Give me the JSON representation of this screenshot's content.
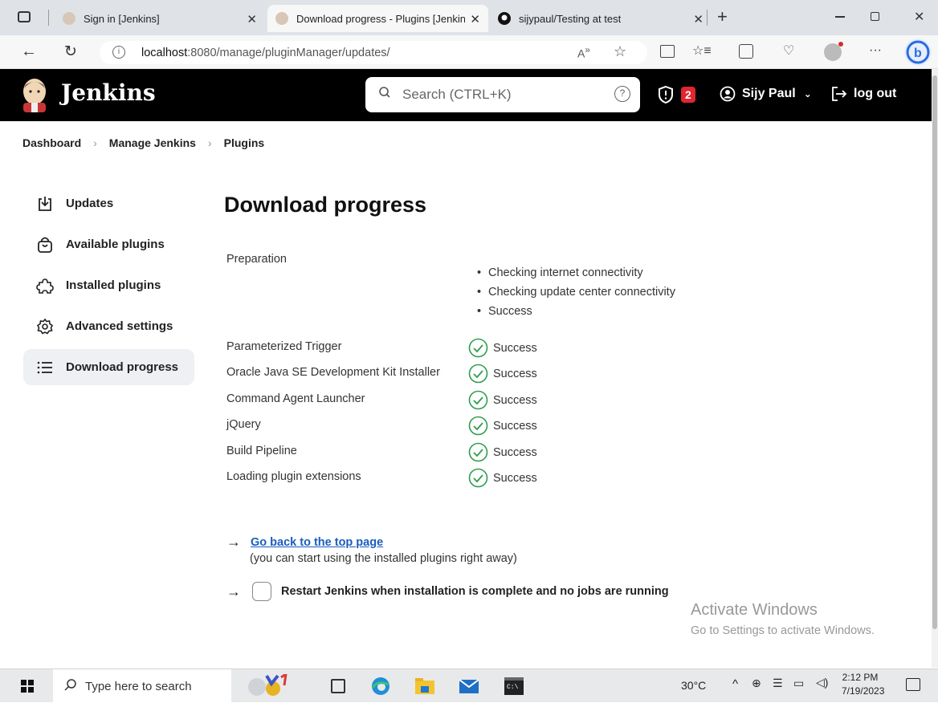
{
  "browser": {
    "tabs": [
      {
        "title": "Sign in [Jenkins]",
        "active": false
      },
      {
        "title": "Download progress - Plugins [Jenkins]",
        "active": true
      },
      {
        "title": "sijypaul/Testing at test",
        "active": false
      }
    ],
    "url_host": "localhost",
    "url_rest": ":8080/manage/pluginManager/updates/"
  },
  "header": {
    "brand": "Jenkins",
    "search_placeholder": "Search (CTRL+K)",
    "security_count": "2",
    "user": "Sijy Paul",
    "logout": "log out"
  },
  "breadcrumb": [
    "Dashboard",
    "Manage Jenkins",
    "Plugins"
  ],
  "sidebar": {
    "items": [
      {
        "label": "Updates",
        "icon": "download-icon"
      },
      {
        "label": "Available plugins",
        "icon": "shopping-bag-icon"
      },
      {
        "label": "Installed plugins",
        "icon": "puzzle-icon"
      },
      {
        "label": "Advanced settings",
        "icon": "gear-icon"
      },
      {
        "label": "Download progress",
        "icon": "list-icon"
      }
    ]
  },
  "main": {
    "title": "Download progress",
    "preparation_label": "Preparation",
    "preparation_steps": [
      "Checking internet connectivity",
      "Checking update center connectivity",
      "Success"
    ],
    "plugins": [
      {
        "name": "Parameterized Trigger",
        "status": "Success"
      },
      {
        "name": "Oracle Java SE Development Kit Installer",
        "status": "Success"
      },
      {
        "name": "Command Agent Launcher",
        "status": "Success"
      },
      {
        "name": "jQuery",
        "status": "Success"
      },
      {
        "name": "Build Pipeline",
        "status": "Success"
      },
      {
        "name": "Loading plugin extensions",
        "status": "Success"
      }
    ],
    "go_back_link": "Go back to the top page",
    "go_back_note": "(you can start using the installed plugins right away)",
    "restart_label": "Restart Jenkins when installation is complete and no jobs are running"
  },
  "watermark": {
    "title": "Activate Windows",
    "subtitle": "Go to Settings to activate Windows."
  },
  "taskbar": {
    "search_placeholder": "Type here to search",
    "weather": "30°C",
    "time": "2:12 PM",
    "date": "7/19/2023"
  },
  "colors": {
    "jenkins_header": "#000000",
    "link": "#1a5dbf",
    "success": "#2e9e4f",
    "badge": "#e0262f"
  }
}
